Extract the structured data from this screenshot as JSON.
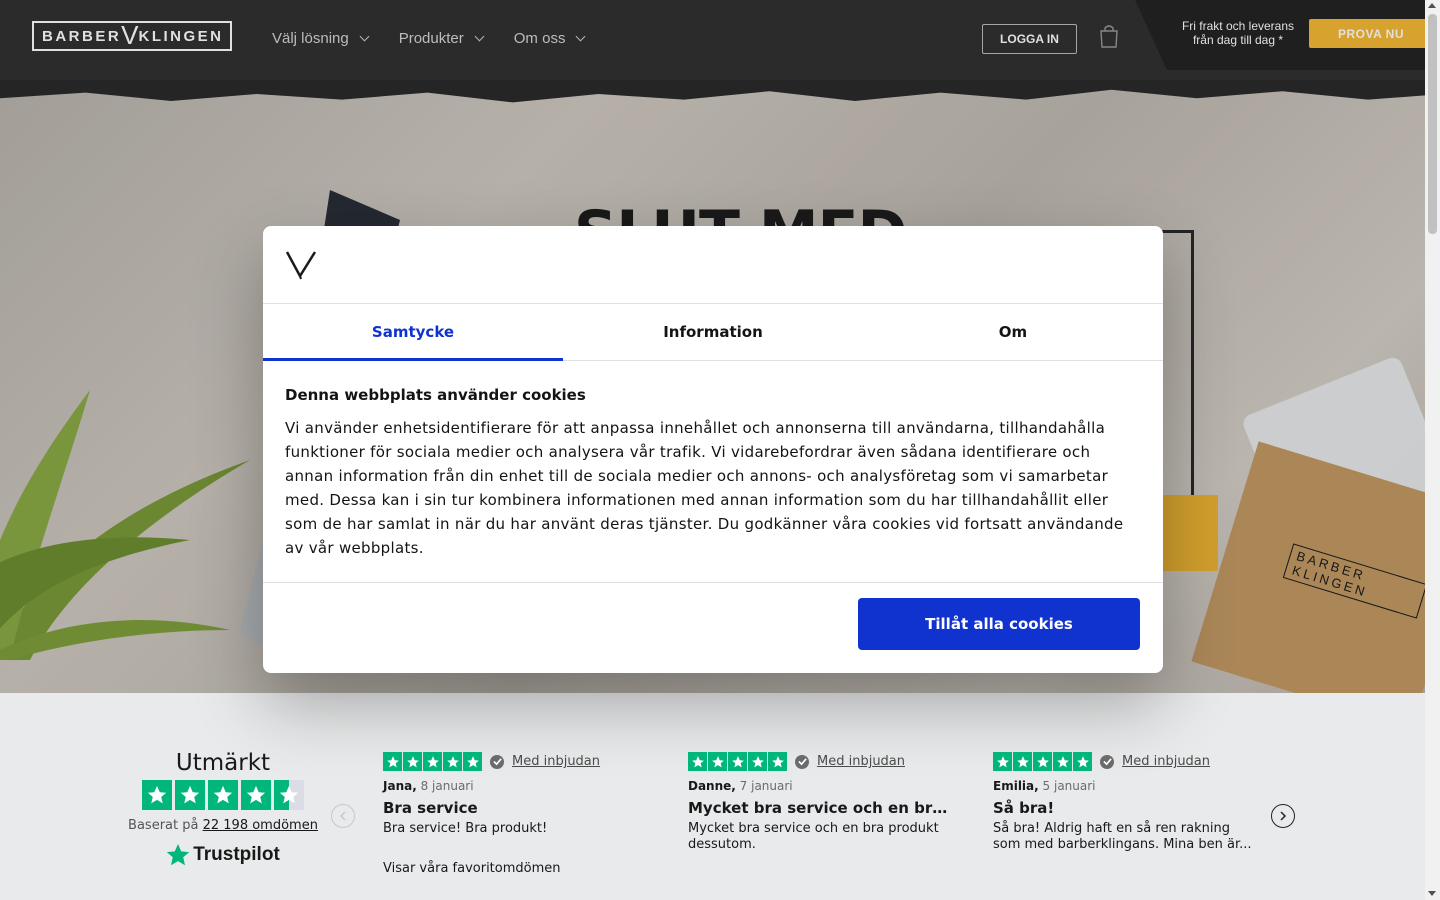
{
  "header": {
    "logo_left": "BARBER",
    "logo_right": "KLINGEN",
    "nav": [
      {
        "label": "Välj lösning"
      },
      {
        "label": "Produkter"
      },
      {
        "label": "Om oss"
      }
    ],
    "login_label": "LOGGA IN",
    "promo_line1": "Fri frakt och leverans",
    "promo_line2": "från dag till dag *",
    "cta_label": "PROVA NU"
  },
  "hero": {
    "title": "SLUT MED",
    "pack_logo": "BARBER KLINGEN"
  },
  "cookie_modal": {
    "tabs": [
      {
        "label": "Samtycke",
        "active": true
      },
      {
        "label": "Information",
        "active": false
      },
      {
        "label": "Om",
        "active": false
      }
    ],
    "heading": "Denna webbplats använder cookies",
    "body": "Vi använder enhetsidentifierare för att anpassa innehållet och annonserna till användarna, tillhandahålla funktioner för sociala medier och analysera vår trafik. Vi vidarebefordrar även sådana identifierare och annan information från din enhet till de sociala medier och annons- och analysföretag som vi samarbetar med. Dessa kan i sin tur kombinera informationen med annan information som du har tillhandahållit eller som de har samlat in när du har använt deras tjänster. Du godkänner våra cookies vid fortsatt användande av vår webbplats.",
    "allow_label": "Tillåt alla cookies"
  },
  "trustpilot": {
    "rating_word": "Utmärkt",
    "based_prefix": "Baserat på",
    "based_link": "22 198 omdömen",
    "brand": "Trustpilot",
    "star_rating": 4.5,
    "green": "#00b67a",
    "favorites_label": "Visar våra favoritomdömen",
    "reviews": [
      {
        "invite": "Med inbjudan",
        "author": "Jana,",
        "date": "8 januari",
        "title": "Bra service",
        "text": "Bra service! Bra produkt!"
      },
      {
        "invite": "Med inbjudan",
        "author": "Danne,",
        "date": "7 januari",
        "title": "Mycket bra service och en bra ...",
        "text": "Mycket bra service och en bra produkt dessutom."
      },
      {
        "invite": "Med inbjudan",
        "author": "Emilia,",
        "date": "5 januari",
        "title": "Så bra!",
        "text": "Så bra! Aldrig haft en så ren rakning som med barberklingans. Mina ben är..."
      }
    ]
  },
  "colors": {
    "header_bg": "#313131",
    "accent_yellow": "#f6b936",
    "primary_blue": "#1032cf"
  }
}
